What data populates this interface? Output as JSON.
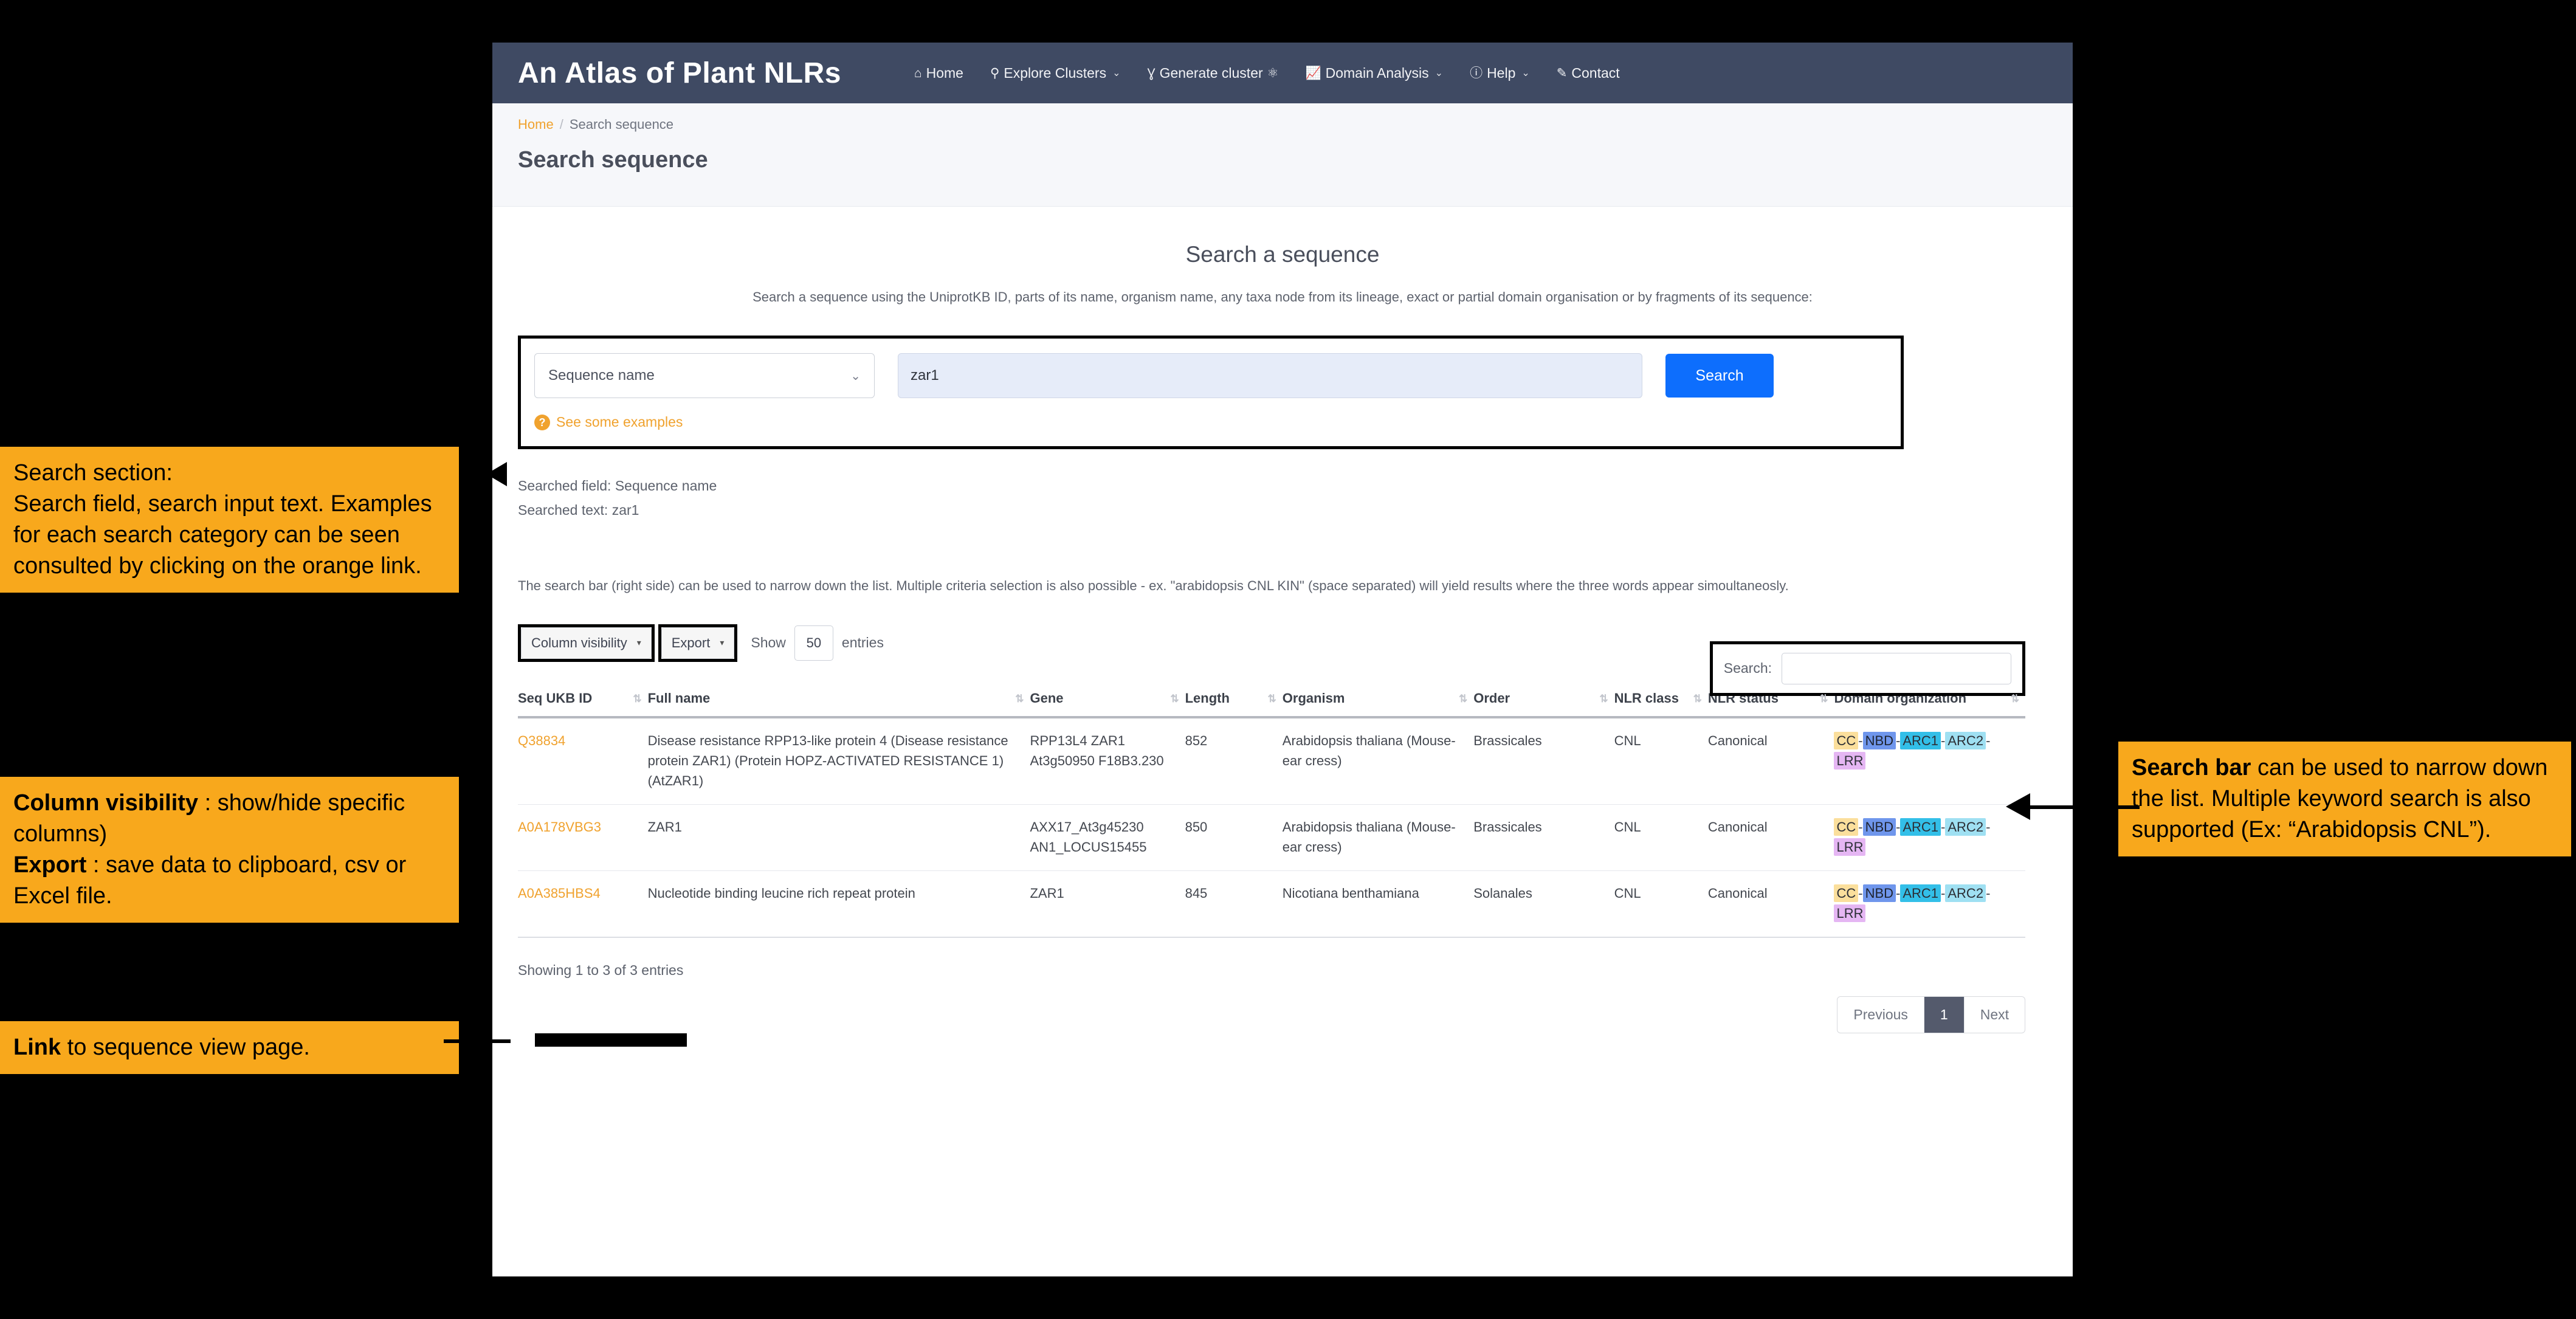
{
  "navbar": {
    "brand": "An Atlas of Plant NLRs",
    "items": [
      {
        "icon": "home-icon",
        "glyph": "⌂",
        "label": "Home",
        "caret": ""
      },
      {
        "icon": "person-icon",
        "glyph": "⚲",
        "label": "Explore Clusters",
        "caret": "⌄"
      },
      {
        "icon": "cluster-icon",
        "glyph": "Ɣ",
        "label": "Generate cluster",
        "caret": ""
      },
      {
        "icon": "chart-icon",
        "glyph": "ᴸ",
        "label": "Domain Analysis",
        "caret": "⌄"
      },
      {
        "icon": "info-icon",
        "glyph": "ⓘ",
        "label": "Help",
        "caret": "⌄"
      },
      {
        "icon": "pen-icon",
        "glyph": "✎",
        "label": "Contact",
        "caret": ""
      }
    ]
  },
  "breadcrumb": {
    "home": "Home",
    "separator": "/",
    "current": "Search sequence"
  },
  "page_title": "Search sequence",
  "section": {
    "title": "Search a sequence",
    "description": "Search a sequence using the UniprotKB ID, parts of its name, organism name, any taxa node from its lineage, exact or partial domain organisation or by fragments of its sequence:"
  },
  "search_panel": {
    "field_selected": "Sequence name",
    "field_caret": "⌄",
    "query_value": "zar1",
    "query_placeholder": "",
    "search_button": "Search",
    "examples_link": "See some examples",
    "examples_badge": "?"
  },
  "searched_info": {
    "field_line": "Searched field: Sequence name",
    "text_line": "Searched text: zar1"
  },
  "narrow_note": "The search bar (right side) can be used to narrow down the list. Multiple criteria selection is also possible - ex. \"arabidopsis CNL KIN\" (space separated) will yield results where the three words appear simoultaneosly.",
  "table_controls": {
    "column_visibility": "Column visibility",
    "export": "Export",
    "caret": "▾",
    "show_label": "Show",
    "entries_value": "50",
    "entries_label": "entries",
    "search_label": "Search:",
    "search_value": "",
    "search_placeholder": ""
  },
  "table": {
    "sort_icon": "⇅",
    "columns": [
      "Seq UKB ID",
      "Full name",
      "Gene",
      "Length",
      "Organism",
      "Order",
      "NLR class",
      "NLR status",
      "Domain organization"
    ],
    "rows": [
      {
        "id": "Q38834",
        "full_name": "Disease resistance RPP13-like protein 4 (Disease resistance protein ZAR1) (Protein HOPZ-ACTIVATED RESISTANCE 1) (AtZAR1)",
        "gene": "RPP13L4 ZAR1 At3g50950 F18B3.230",
        "length": "852",
        "organism": "Arabidopsis thaliana (Mouse-ear cress)",
        "order": "Brassicales",
        "nlr_class": "CNL",
        "nlr_status": "Canonical",
        "domains": [
          "CC",
          "NBD",
          "ARC1",
          "ARC2",
          "LRR"
        ]
      },
      {
        "id": "A0A178VBG3",
        "full_name": "ZAR1",
        "gene": "AXX17_At3g45230 AN1_LOCUS15455",
        "length": "850",
        "organism": "Arabidopsis thaliana (Mouse-ear cress)",
        "order": "Brassicales",
        "nlr_class": "CNL",
        "nlr_status": "Canonical",
        "domains": [
          "CC",
          "NBD",
          "ARC1",
          "ARC2",
          "LRR"
        ]
      },
      {
        "id": "A0A385HBS4",
        "full_name": "Nucleotide binding leucine rich repeat protein",
        "gene": "ZAR1",
        "length": "845",
        "organism": "Nicotiana benthamiana",
        "order": "Solanales",
        "nlr_class": "CNL",
        "nlr_status": "Canonical",
        "domains": [
          "CC",
          "NBD",
          "ARC1",
          "ARC2",
          "LRR"
        ]
      }
    ]
  },
  "footer": {
    "showing": "Showing 1 to 3 of 3 entries",
    "previous": "Previous",
    "page": "1",
    "next": "Next"
  },
  "annotations": {
    "search_section": {
      "heading": "Search section:",
      "body": "Search field, search input text. Examples for each search category can be seen consulted by clicking on the orange link."
    },
    "columns": {
      "term1": "Column visibility",
      "body1": " : show/hide specific columns)",
      "term2": "Export",
      "body2": " : save data to clipboard, csv or Excel file."
    },
    "link": {
      "term": "Link",
      "body": " to sequence view page."
    },
    "search_bar": {
      "term": "Search bar",
      "body": " can be used to narrow down the list. Multiple keyword search is also supported (Ex: “Arabidopsis CNL”)."
    }
  },
  "colors": {
    "navbar_bg": "#3f4a63",
    "accent_orange": "#f0a22e",
    "primary_blue": "#0d6efd",
    "callout_bg": "#f8a81c",
    "dom_cc": "#fbdf9c",
    "dom_nbd": "#6f96ec",
    "dom_arc1": "#33bfe8",
    "dom_arc2": "#9fe0f2",
    "dom_lrr": "#e5b6f3"
  }
}
